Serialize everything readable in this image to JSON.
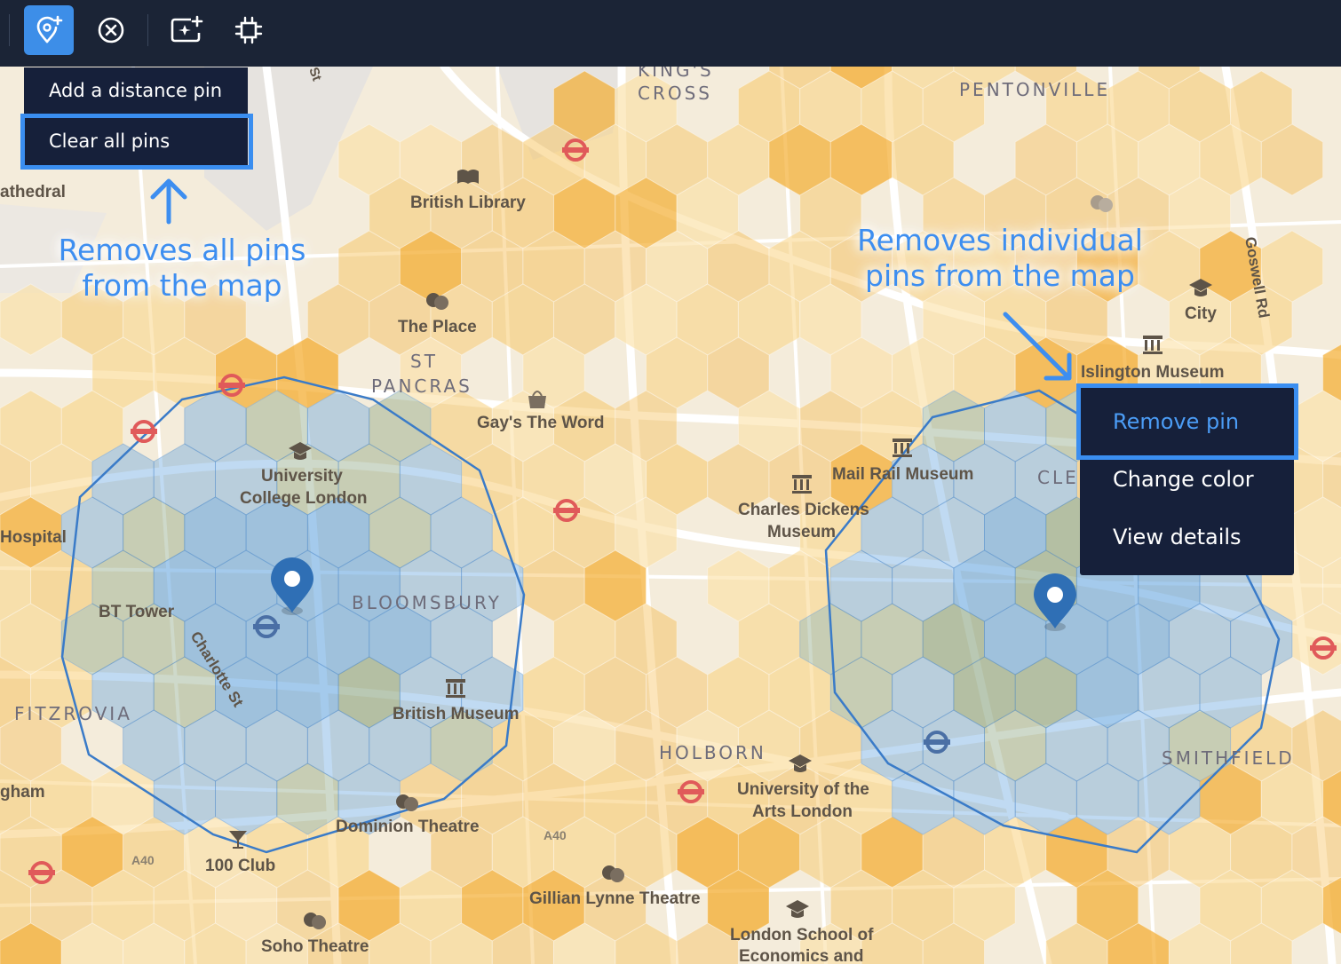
{
  "toolbar": {
    "buttons": [
      {
        "icon": "add-pin-icon",
        "active": true
      },
      {
        "icon": "clear-circle-icon",
        "active": false
      },
      {
        "icon": "add-image-icon",
        "active": false
      },
      {
        "icon": "crop-focus-icon",
        "active": false
      }
    ]
  },
  "pins_menu": {
    "add_label": "Add a distance pin",
    "clear_label": "Clear all pins"
  },
  "pin_menu": {
    "remove_label": "Remove pin",
    "change_color_label": "Change color",
    "view_details_label": "View details"
  },
  "annotations": {
    "clear_all_line1": "Removes all pins",
    "clear_all_line2": "from the map",
    "remove_line1": "Removes individual",
    "remove_line2": "pins from the map"
  },
  "map": {
    "districts": {
      "kings_cross_1": "KING'S",
      "kings_cross_2": "CROSS",
      "pentonville": "PENTONVILLE",
      "st_pancras_1": "ST",
      "st_pancras_2": "PANCRAS",
      "bloomsbury": "BLOOMSBURY",
      "fitzrovia": "FITZROVIA",
      "holborn": "HOLBORN",
      "smithfield": "SMITHFIELD",
      "clerkenwell_partial": "CLE"
    },
    "places": {
      "cathedral": "athedral",
      "british_library": "British Library",
      "the_place": "The Place",
      "gays_the_word": "Gay's The Word",
      "ucl_1": "University",
      "ucl_2": "College London",
      "hospital": "Hospital",
      "bt_tower": "BT Tower",
      "charlotte_st": "Charlotte St",
      "british_museum": "British Museum",
      "mail_rail": "Mail Rail Museum",
      "dickens_1": "Charles Dickens",
      "dickens_2": "Museum",
      "islington_museum": "Islington Museum",
      "city": "City",
      "goswell_rd": "Goswell Rd",
      "ual_1": "University of the",
      "ual_2": "Arts London",
      "dominion": "Dominion Theatre",
      "club100": "100 Club",
      "gillian": "Gillian Lynne Theatre",
      "soho_theatre": "Soho Theatre",
      "lse_1": "London School of",
      "lse_2": "Economics and",
      "gham": "gham",
      "a40_1": "A40",
      "a40_2": "A40",
      "street_st": "St"
    }
  },
  "colors": {
    "toolbar_bg": "#1b2436",
    "accent": "#3d8ee8",
    "menu_bg": "#16203a",
    "hex_orange": "#f5b43c",
    "hex_blue": "#5a9fdc",
    "pin": "#2f6fb5"
  }
}
